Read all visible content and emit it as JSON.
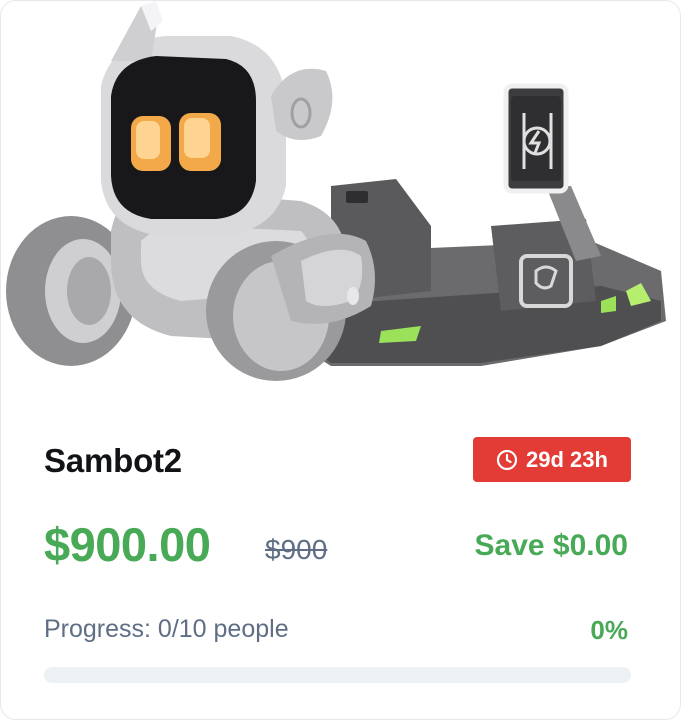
{
  "product": {
    "name": "Sambot2",
    "image_alt": "robot-with-charging-dock",
    "timer_icon": "clock-icon",
    "timer": "29d 23h",
    "price": "$900.00",
    "original_price": "$900",
    "savings": "Save $0.00",
    "progress_text": "Progress: 0/10 people",
    "progress_percent_label": "0%",
    "progress_fraction": 0
  },
  "colors": {
    "accent_green": "#48a957",
    "badge_red": "#e33b35",
    "muted_text": "#5f6e85"
  }
}
